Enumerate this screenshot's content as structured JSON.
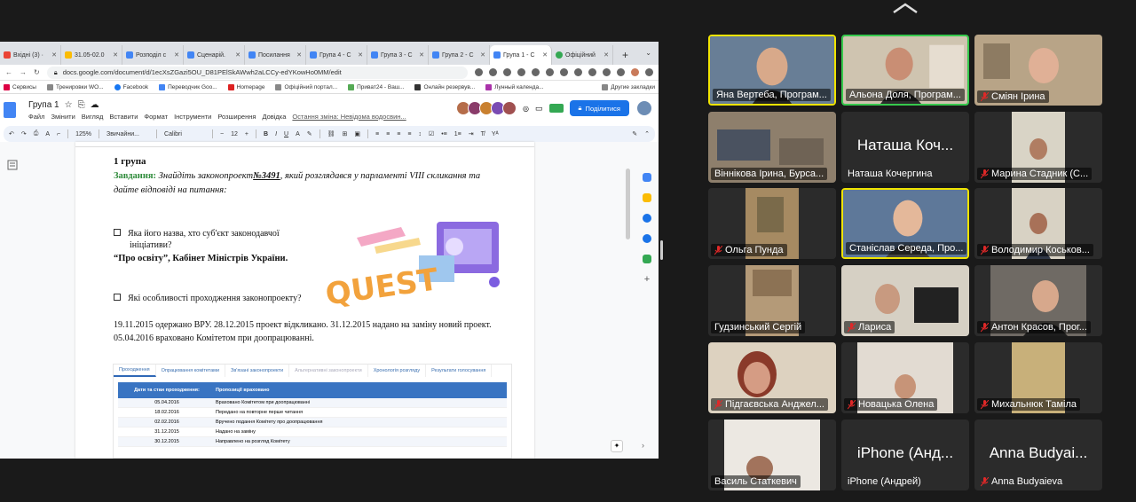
{
  "browser": {
    "tabs": [
      "Вхідні (3) ·",
      "31.05-02.0",
      "Розподіл с",
      "Сценарій.",
      "Посилання",
      "Група 4 - С",
      "Група 3 - С",
      "Група 2 - С",
      "Група 1 - С",
      "Офіційний"
    ],
    "active_tab": 8,
    "url": "docs.google.com/document/d/1ecXsZGazi5OU_D81PElSkAWwh2aLCCy-edYKowHo0MM/edit",
    "bookmarks": [
      "Сервисы",
      "Тренировки WO...",
      "Facebook",
      "Переводчик Goo...",
      "Homepage",
      "Офіційний портал...",
      "Приват24 - Ваш...",
      "Онлайн резервув...",
      "Лунный календа..."
    ],
    "other_bookmarks": "Другие закладки"
  },
  "docs": {
    "title": "Група 1",
    "menu": [
      "Файл",
      "Змінити",
      "Вигляд",
      "Вставити",
      "Формат",
      "Інструменти",
      "Розширення",
      "Довідка"
    ],
    "last_edit": "Остання зміна: Невідома водосвин...",
    "share_label": "Поділитися",
    "zoom": "125%",
    "style": "Звичайни...",
    "font": "Calibri",
    "font_size": "12"
  },
  "document": {
    "heading": "1 група",
    "task_label": "Завдання:",
    "task_text_1": "Знайдіть законопроект",
    "bill_number": "№3491",
    "task_text_2": ", який розглядався у парламенті VIII скликання та",
    "task_text_3": "дайте відповіді на питання:",
    "q1_line1": "Яка його назва, хто суб'єкт законодавчої",
    "q1_line2": "ініціативи?",
    "answer1": "“Про освіту”, Кабінет Міністрів України.",
    "q2": "Які особливості проходження законопроекту?",
    "answer2_line1": "19.11.2015 одержано ВРУ. 28.12.2015 проект відкликано. 31.12.2015 надано на заміну новий проект.",
    "answer2_line2": "05.04.2016 враховано Комітетом при доопрацюванні.",
    "illustration_text": "QUEST",
    "table_tabs": [
      "Проходження",
      "Опрацювання комітетами",
      "Зв'язані законопроекти",
      "Альтернативні законопроекти",
      "Хронологія розгляду",
      "Результати голосування"
    ],
    "table_header": [
      "Дати та стан проходження:",
      "Пропозиції враховано"
    ],
    "table_rows": [
      [
        "05.04.2016",
        "Враховано Комітетом при доопрацюванні"
      ],
      [
        "18.02.2016",
        "Передано на повторне перше читання"
      ],
      [
        "02.02.2016",
        "Вручено подання Комітету про доопрацювання"
      ],
      [
        "31.12.2015",
        "Надано на заміну"
      ],
      [
        "30.12.2015",
        "Направлено на розгляд Комітету"
      ]
    ]
  },
  "participants": [
    {
      "name": "Яна Вертеба, Програм...",
      "muted": false,
      "video": true
    },
    {
      "name": "Альона Доля, Програм...",
      "muted": false,
      "video": true
    },
    {
      "name": "Сміян Ірина",
      "muted": true,
      "video": true
    },
    {
      "name": "Віннікова Ірина, Бурса...",
      "muted": false,
      "video": true
    },
    {
      "name": "Наташа Кочергина",
      "big": "Наташа Коч...",
      "muted": false,
      "video": false
    },
    {
      "name": "Марина Стадник (С...",
      "muted": true,
      "video": true
    },
    {
      "name": "Ольга Пунда",
      "muted": true,
      "video": true
    },
    {
      "name": "Станіслав Середа, Про...",
      "muted": false,
      "video": true
    },
    {
      "name": "Володимир Коськов...",
      "muted": true,
      "video": true
    },
    {
      "name": "Гудзинський Сергій",
      "muted": false,
      "video": true
    },
    {
      "name": "Лариса",
      "muted": true,
      "video": true
    },
    {
      "name": "Антон Красов, Прог...",
      "muted": true,
      "video": true
    },
    {
      "name": "Підгаєвська Анджел...",
      "muted": true,
      "video": true
    },
    {
      "name": "Новацька Олена",
      "muted": true,
      "video": true
    },
    {
      "name": "Михальнюк Таміла",
      "muted": true,
      "video": true
    },
    {
      "name": "Василь Статкевич",
      "muted": false,
      "video": true
    },
    {
      "name": "iPhone (Андрей)",
      "big": "iPhone (Анд...",
      "muted": false,
      "video": false
    },
    {
      "name": "Anna Budyaieva",
      "big": "Anna Budyai...",
      "muted": true,
      "video": false
    }
  ]
}
